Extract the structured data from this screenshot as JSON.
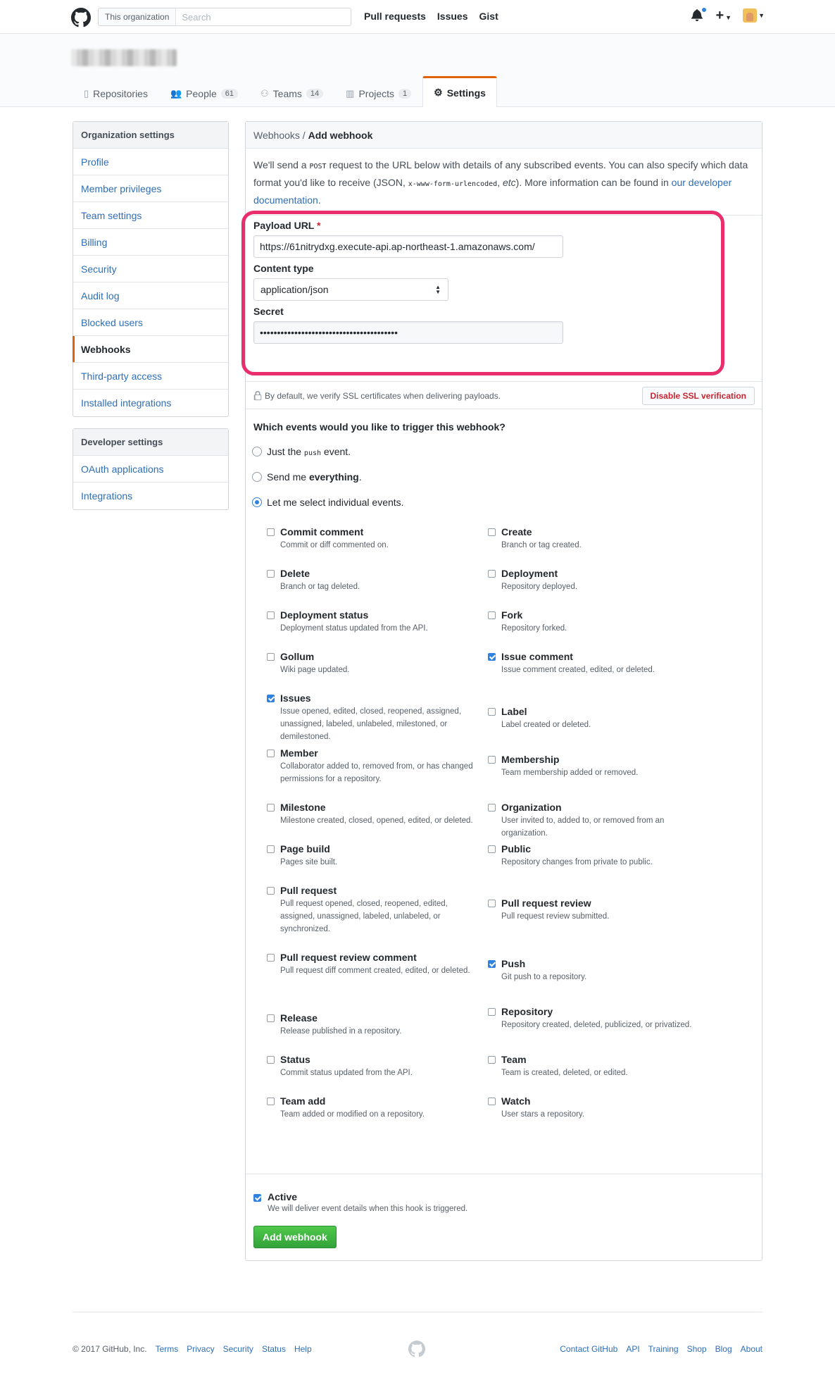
{
  "header": {
    "search_scope": "This organization",
    "search_placeholder": "Search",
    "nav": [
      "Pull requests",
      "Issues",
      "Gist"
    ]
  },
  "org": {
    "tabs": [
      {
        "label": "Repositories",
        "count": ""
      },
      {
        "label": "People",
        "count": "61"
      },
      {
        "label": "Teams",
        "count": "14"
      },
      {
        "label": "Projects",
        "count": "1"
      },
      {
        "label": "Settings",
        "count": ""
      }
    ]
  },
  "sidebar": {
    "org_heading": "Organization settings",
    "org_items": [
      "Profile",
      "Member privileges",
      "Team settings",
      "Billing",
      "Security",
      "Audit log",
      "Blocked users",
      "Webhooks",
      "Third-party access",
      "Installed integrations"
    ],
    "dev_heading": "Developer settings",
    "dev_items": [
      "OAuth applications",
      "Integrations"
    ]
  },
  "panel": {
    "breadcrumb_parent": "Webhooks",
    "breadcrumb_sep": " / ",
    "breadcrumb_current": "Add webhook",
    "intro_1": "We'll send a ",
    "intro_post": "POST",
    "intro_2": " request to the URL below with details of any subscribed events. You can also specify which data format you'd like to receive (JSON, ",
    "intro_code": "x-www-form-urlencoded",
    "intro_3": ", ",
    "intro_etc": "etc",
    "intro_4": "). More information can be found in ",
    "intro_link": "our developer documentation",
    "intro_5": ".",
    "payload_label": "Payload URL",
    "required_mark": "*",
    "payload_value": "https://61nitrydxg.execute-api.ap-northeast-1.amazonaws.com/",
    "content_type_label": "Content type",
    "content_type_value": "application/json",
    "secret_label": "Secret",
    "secret_value": "••••••••••••••••••••••••••••••••••••••••",
    "ssl_text": "By default, we verify SSL certificates when delivering payloads.",
    "ssl_button": "Disable SSL verification",
    "events_question": "Which events would you like to trigger this webhook?",
    "radio_push_1": "Just the ",
    "radio_push_code": "push",
    "radio_push_2": " event.",
    "radio_everything_1": "Send me ",
    "radio_everything_bold": "everything",
    "radio_everything_2": ".",
    "radio_select": "Let me select individual events.",
    "events": [
      {
        "name": "Commit comment",
        "desc": "Commit or diff commented on.",
        "checked": false
      },
      {
        "name": "Create",
        "desc": "Branch or tag created.",
        "checked": false
      },
      {
        "name": "Delete",
        "desc": "Branch or tag deleted.",
        "checked": false
      },
      {
        "name": "Deployment",
        "desc": "Repository deployed.",
        "checked": false
      },
      {
        "name": "Deployment status",
        "desc": "Deployment status updated from the API.",
        "checked": false
      },
      {
        "name": "Fork",
        "desc": "Repository forked.",
        "checked": false
      },
      {
        "name": "Gollum",
        "desc": "Wiki page updated.",
        "checked": false
      },
      {
        "name": "Issue comment",
        "desc": "Issue comment created, edited, or deleted.",
        "checked": true
      },
      {
        "name": "Issues",
        "desc": "Issue opened, edited, closed, reopened, assigned, unassigned, labeled, unlabeled, milestoned, or demilestoned.",
        "checked": true
      },
      {
        "name": "Label",
        "desc": "Label created or deleted.",
        "checked": false
      },
      {
        "name": "Member",
        "desc": "Collaborator added to, removed from, or has changed permissions for a repository.",
        "checked": false
      },
      {
        "name": "Membership",
        "desc": "Team membership added or removed.",
        "checked": false
      },
      {
        "name": "Milestone",
        "desc": "Milestone created, closed, opened, edited, or deleted.",
        "checked": false
      },
      {
        "name": "Organization",
        "desc": "User invited to, added to, or removed from an organization.",
        "checked": false
      },
      {
        "name": "Page build",
        "desc": "Pages site built.",
        "checked": false
      },
      {
        "name": "Public",
        "desc": "Repository changes from private to public.",
        "checked": false
      },
      {
        "name": "Pull request",
        "desc": "Pull request opened, closed, reopened, edited, assigned, unassigned, labeled, unlabeled, or synchronized.",
        "checked": false
      },
      {
        "name": "Pull request review",
        "desc": "Pull request review submitted.",
        "checked": false
      },
      {
        "name": "Pull request review comment",
        "desc": "Pull request diff comment created, edited, or deleted.",
        "checked": false
      },
      {
        "name": "Push",
        "desc": "Git push to a repository.",
        "checked": true
      },
      {
        "name": "Release",
        "desc": "Release published in a repository.",
        "checked": false
      },
      {
        "name": "Repository",
        "desc": "Repository created, deleted, publicized, or privatized.",
        "checked": false
      },
      {
        "name": "Status",
        "desc": "Commit status updated from the API.",
        "checked": false
      },
      {
        "name": "Team",
        "desc": "Team is created, deleted, or edited.",
        "checked": false
      },
      {
        "name": "Team add",
        "desc": "Team added or modified on a repository.",
        "checked": false
      },
      {
        "name": "Watch",
        "desc": "User stars a repository.",
        "checked": false
      }
    ],
    "active_label": "Active",
    "active_desc": "We will deliver event details when this hook is triggered.",
    "add_button": "Add webhook"
  },
  "footer": {
    "copyright": "© 2017 GitHub, Inc.",
    "left_links": [
      "Terms",
      "Privacy",
      "Security",
      "Status",
      "Help"
    ],
    "right_links": [
      "Contact GitHub",
      "API",
      "Training",
      "Shop",
      "Blog",
      "About"
    ]
  },
  "colors": {
    "link": "#2f6eb5",
    "accent_orange": "#e36209",
    "highlight_pink": "#ea2d6d",
    "primary_green": "#33a33a",
    "danger_red": "#cb2431"
  }
}
